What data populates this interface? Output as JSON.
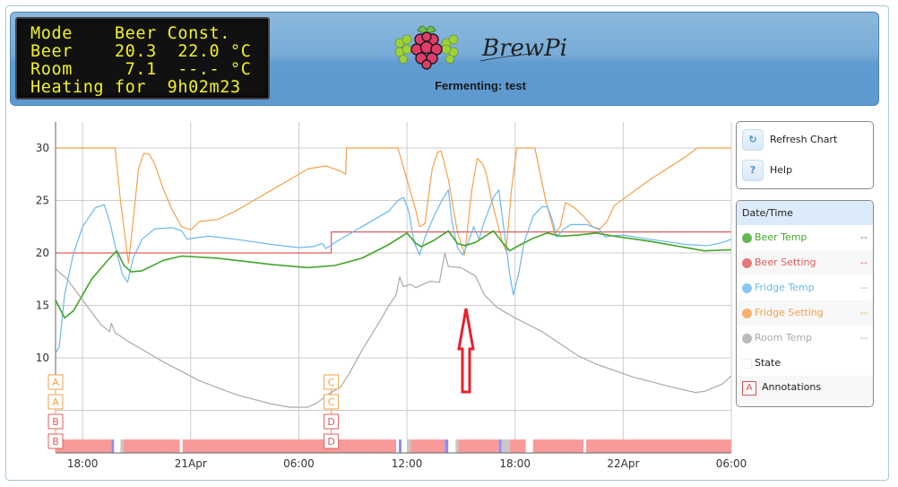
{
  "lcd": {
    "lines": [
      "Mode    Beer Const.",
      "Beer    20.3  22.0 °C",
      "Room     7.1  --.- °C",
      "Heating for  9h02m23"
    ]
  },
  "header": {
    "logo_text": "BrewPi",
    "status": "Fermenting: test"
  },
  "controls": {
    "refresh_label": "Refresh Chart",
    "refresh_icon": "refresh-icon",
    "help_label": "Help",
    "help_icon_glyph": "?"
  },
  "legend": {
    "header": "Date/Time",
    "items": [
      {
        "label": "Beer Temp",
        "value": "--",
        "color": "#41a62a"
      },
      {
        "label": "Beer Setting",
        "value": "--",
        "color": "#e05c5c"
      },
      {
        "label": "Fridge Temp",
        "value": "--",
        "color": "#6ab8f0"
      },
      {
        "label": "Fridge Setting",
        "value": "--",
        "color": "#f5a04a"
      },
      {
        "label": "Room Temp",
        "value": "--",
        "color": "#aaaaaa"
      }
    ],
    "state_label": "State",
    "annotations_label": "Annotations",
    "annotations_glyph": "A"
  },
  "chart_data": {
    "type": "line",
    "title": "",
    "xlabel": "",
    "ylabel": "",
    "ylim": [
      3,
      33
    ],
    "yticks": [
      10,
      15,
      20,
      25,
      30
    ],
    "x_range_hours": [
      0,
      37.5
    ],
    "xtick_labels": [
      {
        "label": "18:00",
        "h": 1.5
      },
      {
        "label": "21Apr",
        "h": 7.5
      },
      {
        "label": "06:00",
        "h": 13.5
      },
      {
        "label": "12:00",
        "h": 19.5
      },
      {
        "label": "18:00",
        "h": 25.5
      },
      {
        "label": "22Apr",
        "h": 31.5
      },
      {
        "label": "06:00",
        "h": 37.5
      }
    ],
    "grid": true,
    "series": [
      {
        "name": "Fridge Setting",
        "color": "#f5a04a",
        "points": [
          [
            0,
            30
          ],
          [
            3.3,
            30
          ],
          [
            3.6,
            25
          ],
          [
            3.9,
            21
          ],
          [
            4.05,
            19
          ],
          [
            4.3,
            23
          ],
          [
            4.6,
            28
          ],
          [
            4.9,
            29.5
          ],
          [
            5.2,
            29.4
          ],
          [
            5.5,
            28.5
          ],
          [
            6.0,
            26
          ],
          [
            6.5,
            24
          ],
          [
            7.0,
            22.5
          ],
          [
            7.5,
            22.2
          ],
          [
            8.0,
            23
          ],
          [
            9.0,
            23.2
          ],
          [
            10.0,
            24
          ],
          [
            11.0,
            25
          ],
          [
            12.0,
            26
          ],
          [
            13.0,
            27
          ],
          [
            14.0,
            28
          ],
          [
            15.0,
            28.3
          ],
          [
            15.8,
            27.8
          ],
          [
            16.1,
            27.5
          ],
          [
            16.15,
            30
          ],
          [
            19.0,
            30
          ],
          [
            19.5,
            27
          ],
          [
            20.0,
            24
          ],
          [
            20.2,
            22.5
          ],
          [
            20.5,
            22.8
          ],
          [
            20.9,
            28
          ],
          [
            21.2,
            29.6
          ],
          [
            21.4,
            29.7
          ],
          [
            21.8,
            27
          ],
          [
            22.3,
            22
          ],
          [
            22.7,
            19.8
          ],
          [
            23.1,
            26
          ],
          [
            23.4,
            29
          ],
          [
            23.7,
            28.5
          ],
          [
            23.9,
            27.6
          ],
          [
            24.2,
            25
          ],
          [
            24.8,
            21
          ],
          [
            25.0,
            20.2
          ],
          [
            25.3,
            26
          ],
          [
            25.6,
            30
          ],
          [
            26.6,
            30
          ],
          [
            27.2,
            25
          ],
          [
            27.7,
            21.8
          ],
          [
            28.0,
            22.5
          ],
          [
            28.3,
            24.8
          ],
          [
            28.8,
            24.3
          ],
          [
            29.3,
            23.5
          ],
          [
            29.8,
            22.5
          ],
          [
            30.2,
            22.3
          ],
          [
            30.6,
            23
          ],
          [
            31.0,
            24.5
          ],
          [
            33.0,
            27
          ],
          [
            35.0,
            29.2
          ],
          [
            35.6,
            30
          ],
          [
            37.5,
            30
          ]
        ]
      },
      {
        "name": "Beer Setting",
        "color": "#e05c5c",
        "points": [
          [
            0,
            20
          ],
          [
            15.3,
            20
          ],
          [
            15.3,
            22
          ],
          [
            37.5,
            22
          ]
        ]
      },
      {
        "name": "Fridge Temp",
        "color": "#6ab8f0",
        "points": [
          [
            0,
            10.5
          ],
          [
            0.2,
            11
          ],
          [
            0.5,
            16
          ],
          [
            1.0,
            20
          ],
          [
            1.5,
            22.5
          ],
          [
            2.2,
            24.3
          ],
          [
            2.7,
            24.6
          ],
          [
            3.0,
            23
          ],
          [
            3.4,
            20
          ],
          [
            3.7,
            18
          ],
          [
            4.0,
            17.2
          ],
          [
            4.3,
            19.5
          ],
          [
            4.8,
            21.3
          ],
          [
            5.5,
            22.3
          ],
          [
            6.5,
            22.4
          ],
          [
            7.0,
            22.1
          ],
          [
            7.3,
            21.3
          ],
          [
            7.6,
            21.4
          ],
          [
            8.5,
            21.6
          ],
          [
            10.0,
            21.3
          ],
          [
            12.0,
            20.8
          ],
          [
            13.5,
            20.5
          ],
          [
            14.3,
            20.6
          ],
          [
            14.8,
            20.9
          ],
          [
            15.0,
            20.4
          ],
          [
            15.5,
            21
          ],
          [
            17.0,
            22.5
          ],
          [
            18.5,
            24
          ],
          [
            19.0,
            25
          ],
          [
            19.3,
            25.3
          ],
          [
            19.6,
            24
          ],
          [
            19.9,
            21
          ],
          [
            20.2,
            19.8
          ],
          [
            20.5,
            21.5
          ],
          [
            21.0,
            23.5
          ],
          [
            21.5,
            25.2
          ],
          [
            21.8,
            26
          ],
          [
            22.0,
            23
          ],
          [
            22.3,
            20.5
          ],
          [
            22.6,
            19.8
          ],
          [
            22.9,
            21
          ],
          [
            23.2,
            22.5
          ],
          [
            23.5,
            21.3
          ],
          [
            23.8,
            23
          ],
          [
            24.3,
            25.3
          ],
          [
            24.6,
            26
          ],
          [
            24.9,
            22
          ],
          [
            25.2,
            18
          ],
          [
            25.4,
            16
          ],
          [
            25.7,
            18
          ],
          [
            26.0,
            21
          ],
          [
            26.5,
            23.5
          ],
          [
            27.0,
            24.4
          ],
          [
            27.3,
            24.4
          ],
          [
            27.6,
            23
          ],
          [
            27.8,
            21.5
          ],
          [
            28.2,
            22.3
          ],
          [
            28.6,
            22.7
          ],
          [
            29.5,
            22.7
          ],
          [
            30.2,
            22.2
          ],
          [
            30.5,
            21.5
          ],
          [
            30.7,
            21.6
          ],
          [
            31.5,
            21.7
          ],
          [
            33.0,
            21.3
          ],
          [
            35.0,
            20.8
          ],
          [
            36.2,
            20.7
          ],
          [
            37.0,
            21
          ],
          [
            37.5,
            21.3
          ]
        ]
      },
      {
        "name": "Beer Temp",
        "color": "#41a62a",
        "points": [
          [
            0,
            15.5
          ],
          [
            0.5,
            13.8
          ],
          [
            1.0,
            14.5
          ],
          [
            2.0,
            17.5
          ],
          [
            3.0,
            19.5
          ],
          [
            3.4,
            20.2
          ],
          [
            3.8,
            18.8
          ],
          [
            4.2,
            18.2
          ],
          [
            4.8,
            18.3
          ],
          [
            6.0,
            19.3
          ],
          [
            7.0,
            19.7
          ],
          [
            9.0,
            19.5
          ],
          [
            12.0,
            18.9
          ],
          [
            14.0,
            18.6
          ],
          [
            15.5,
            18.8
          ],
          [
            17.0,
            19.5
          ],
          [
            18.5,
            20.8
          ],
          [
            19.5,
            21.9
          ],
          [
            20.0,
            20.9
          ],
          [
            20.3,
            20.6
          ],
          [
            21.0,
            21.2
          ],
          [
            21.8,
            22.1
          ],
          [
            22.3,
            20.9
          ],
          [
            22.7,
            20.7
          ],
          [
            23.3,
            21
          ],
          [
            24.3,
            22.1
          ],
          [
            24.8,
            21
          ],
          [
            25.2,
            20.2
          ],
          [
            25.6,
            20.6
          ],
          [
            26.5,
            21.4
          ],
          [
            27.3,
            21.9
          ],
          [
            28.0,
            21.6
          ],
          [
            29.0,
            21.7
          ],
          [
            30.0,
            21.9
          ],
          [
            31.0,
            21.6
          ],
          [
            33.0,
            21.1
          ],
          [
            35.0,
            20.5
          ],
          [
            36.0,
            20.2
          ],
          [
            37.5,
            20.3
          ]
        ]
      },
      {
        "name": "Room Temp",
        "color": "#aaaaaa",
        "points": [
          [
            0,
            18.5
          ],
          [
            0.3,
            18
          ],
          [
            0.6,
            17.6
          ],
          [
            1.5,
            15.5
          ],
          [
            2.5,
            13.2
          ],
          [
            3.0,
            12.5
          ],
          [
            3.1,
            13.3
          ],
          [
            3.3,
            12.4
          ],
          [
            4.0,
            11.6
          ],
          [
            6.0,
            9.6
          ],
          [
            8.0,
            7.8
          ],
          [
            10.0,
            6.5
          ],
          [
            12.0,
            5.6
          ],
          [
            13.0,
            5.3
          ],
          [
            14.0,
            5.3
          ],
          [
            14.5,
            5.7
          ],
          [
            15.2,
            6.6
          ],
          [
            15.8,
            7.2
          ],
          [
            16.3,
            8.5
          ],
          [
            17.0,
            10.7
          ],
          [
            18.0,
            13.5
          ],
          [
            18.5,
            15
          ],
          [
            18.9,
            16
          ],
          [
            19.1,
            17.7
          ],
          [
            19.3,
            16.8
          ],
          [
            19.7,
            17
          ],
          [
            20.0,
            16.7
          ],
          [
            20.8,
            17.3
          ],
          [
            21.3,
            17.2
          ],
          [
            21.6,
            20
          ],
          [
            21.8,
            18.7
          ],
          [
            22.5,
            18.6
          ],
          [
            23.3,
            17.8
          ],
          [
            23.8,
            16
          ],
          [
            24.5,
            14.8
          ],
          [
            25.5,
            13.8
          ],
          [
            27.0,
            12.5
          ],
          [
            29.0,
            10.2
          ],
          [
            30.0,
            9.4
          ],
          [
            32.0,
            8.2
          ],
          [
            34.0,
            7.3
          ],
          [
            35.5,
            6.7
          ],
          [
            36.0,
            6.8
          ],
          [
            37.0,
            7.5
          ],
          [
            37.5,
            8.3
          ]
        ]
      }
    ],
    "state_bands": [
      {
        "from": 0,
        "to": 3.1,
        "state": "heating",
        "color": "#f99a9a"
      },
      {
        "from": 3.1,
        "to": 3.25,
        "state": "cooling",
        "color": "#8e8ef5"
      },
      {
        "from": 3.25,
        "to": 3.6,
        "state": "idle",
        "color": "#ffffff"
      },
      {
        "from": 3.6,
        "to": 3.75,
        "state": "waiting",
        "color": "#c8c8c8"
      },
      {
        "from": 3.75,
        "to": 6.9,
        "state": "heating",
        "color": "#f99a9a"
      },
      {
        "from": 6.9,
        "to": 7.05,
        "state": "idle",
        "color": "#ffffff"
      },
      {
        "from": 7.05,
        "to": 18.9,
        "state": "heating",
        "color": "#f99a9a"
      },
      {
        "from": 18.9,
        "to": 19.05,
        "state": "idle",
        "color": "#ffffff"
      },
      {
        "from": 19.05,
        "to": 19.2,
        "state": "cooling",
        "color": "#8e8ef5"
      },
      {
        "from": 19.2,
        "to": 19.5,
        "state": "idle",
        "color": "#ffffff"
      },
      {
        "from": 19.5,
        "to": 19.7,
        "state": "waiting",
        "color": "#c8c8c8"
      },
      {
        "from": 19.7,
        "to": 21.6,
        "state": "heating",
        "color": "#f99a9a"
      },
      {
        "from": 21.6,
        "to": 21.8,
        "state": "cooling",
        "color": "#8e8ef5"
      },
      {
        "from": 21.8,
        "to": 22.2,
        "state": "idle",
        "color": "#ffffff"
      },
      {
        "from": 22.2,
        "to": 22.35,
        "state": "waiting",
        "color": "#c8c8c8"
      },
      {
        "from": 22.35,
        "to": 24.6,
        "state": "heating",
        "color": "#f99a9a"
      },
      {
        "from": 24.6,
        "to": 24.75,
        "state": "cooling",
        "color": "#8e8ef5"
      },
      {
        "from": 24.75,
        "to": 25.2,
        "state": "waiting",
        "color": "#c8c8c8"
      },
      {
        "from": 25.2,
        "to": 26.1,
        "state": "heating",
        "color": "#f99a9a"
      },
      {
        "from": 26.1,
        "to": 26.5,
        "state": "idle",
        "color": "#ffffff"
      },
      {
        "from": 26.5,
        "to": 29.3,
        "state": "heating",
        "color": "#f99a9a"
      },
      {
        "from": 29.3,
        "to": 29.45,
        "state": "idle",
        "color": "#ffffff"
      },
      {
        "from": 29.45,
        "to": 37.5,
        "state": "heating",
        "color": "#f99a9a"
      }
    ],
    "annotations": [
      {
        "label": "A",
        "h": 0,
        "series": "Fridge Setting",
        "color": "#f5a04a"
      },
      {
        "label": "A",
        "h": 0,
        "series": "Fridge Setting",
        "color": "#f5a04a"
      },
      {
        "label": "B",
        "h": 0,
        "series": "Beer Setting",
        "color": "#e05c5c"
      },
      {
        "label": "B",
        "h": 0,
        "series": "Beer Setting",
        "color": "#e05c5c"
      },
      {
        "label": "C",
        "h": 15.3,
        "series": "Fridge Setting",
        "color": "#f5a04a"
      },
      {
        "label": "C",
        "h": 15.3,
        "series": "Fridge Setting",
        "color": "#f5a04a"
      },
      {
        "label": "D",
        "h": 15.3,
        "series": "Beer Setting",
        "color": "#e05c5c"
      },
      {
        "label": "D",
        "h": 15.3,
        "series": "Beer Setting",
        "color": "#e05c5c"
      }
    ],
    "marker_annotation": {
      "type": "arrow-up",
      "color": "#e8202a",
      "h": 22.9
    }
  }
}
